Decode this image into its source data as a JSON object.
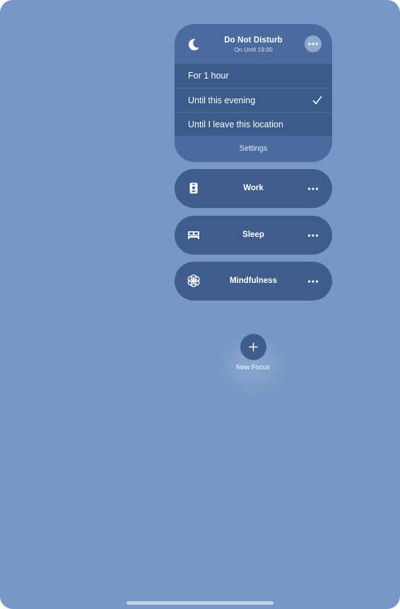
{
  "dnd": {
    "title": "Do Not Disturb",
    "subtitle": "On Until 19:00",
    "icon": "moon-icon",
    "options": [
      {
        "label": "For 1 hour",
        "selected": false
      },
      {
        "label": "Until this evening",
        "selected": true
      },
      {
        "label": "Until I leave this location",
        "selected": false
      }
    ],
    "settings_label": "Settings"
  },
  "focus_modes": [
    {
      "label": "Work",
      "icon": "id-badge-icon"
    },
    {
      "label": "Sleep",
      "icon": "bed-icon"
    },
    {
      "label": "Mindfulness",
      "icon": "flower-icon"
    }
  ],
  "new_focus": {
    "label": "New Focus",
    "icon": "plus-icon"
  },
  "colors": {
    "background": "#7698c6",
    "card": "#4a6b9d",
    "options_bg": "#3b5b8b",
    "pill": "#3e5d8d"
  }
}
